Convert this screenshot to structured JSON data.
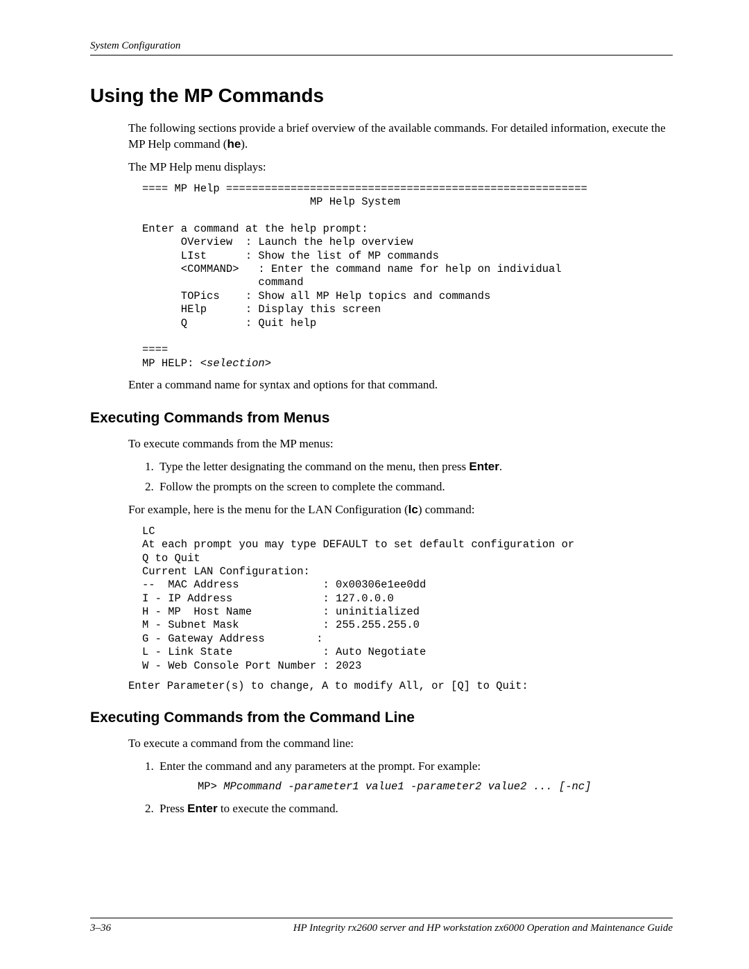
{
  "header": {
    "chapter": "System Configuration"
  },
  "h1": "Using the MP Commands",
  "intro": {
    "p1a": "The following sections provide a brief overview of the available commands. For detailed information, execute the MP Help command (",
    "p1b": "he",
    "p1c": ").",
    "p2": "The MP Help menu displays:"
  },
  "help_block": "==== MP Help ========================================================\n                          MP Help System\n\nEnter a command at the help prompt:\n      OVerview  : Launch the help overview\n      LIst      : Show the list of MP commands\n      <COMMAND>   : Enter the command name for help on individual\n                  command\n      TOPics    : Show all MP Help topics and commands\n      HElp      : Display this screen\n      Q         : Quit help\n\n====\nMP HELP: ",
  "help_selection": "<selection>",
  "after_help": "Enter a command name for syntax and options for that command.",
  "h2a": "Executing Commands from Menus",
  "menus": {
    "intro": "To execute commands from the MP menus:",
    "li1a": "Type the letter designating the command on the menu, then press ",
    "li1b": "Enter",
    "li1c": ".",
    "li2": "Follow the prompts on the screen to complete the command.",
    "example_a": "For example, here is the menu for the LAN Configuration (",
    "example_b": "lc",
    "example_c": ") command:"
  },
  "lc_block": "LC\nAt each prompt you may type DEFAULT to set default configuration or\nQ to Quit\nCurrent LAN Configuration:\n--  MAC Address             : 0x00306e1ee0dd\nI - IP Address              : 127.0.0.0\nH - MP  Host Name           : uninitialized\nM - Subnet Mask             : 255.255.255.0\nG - Gateway Address        :\nL - Link State              : Auto Negotiate\nW - Web Console Port Number : 2023",
  "lc_last": "Enter Parameter(s) to change, A to modify All, or [Q] to Quit:",
  "h2b": "Executing Commands from the Command Line",
  "cmdline": {
    "intro": "To execute a command from the command line:",
    "li1": "Enter the command and any parameters at the prompt. For example:",
    "cmd_prefix": "MP> ",
    "cmd_italic": "MPcommand -parameter1 value1 -parameter2 value2 ... [-nc]",
    "li2a": "Press ",
    "li2b": "Enter",
    "li2c": " to execute the command."
  },
  "footer": {
    "page": "3–36",
    "title": "HP Integrity rx2600 server and HP workstation zx6000 Operation and Maintenance Guide"
  }
}
